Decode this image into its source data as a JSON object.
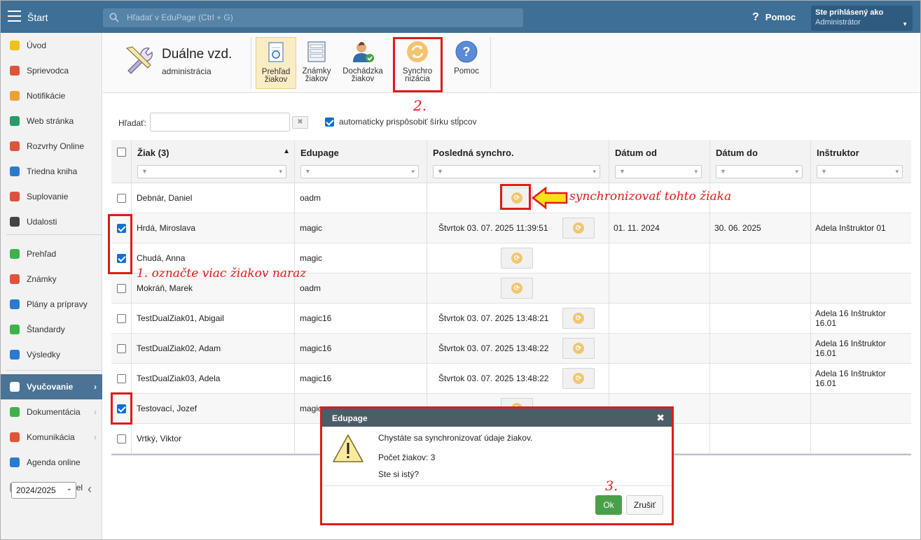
{
  "topbar": {
    "app_label": "Štart",
    "search_placeholder": "Hľadať v EduPage (Ctrl + G)",
    "help_label": "Pomoc",
    "user_title": "Ste prihlásený ako",
    "user_name": "Administrátor"
  },
  "sidebar": {
    "items": [
      {
        "label": "Úvod",
        "icon": "star-icon",
        "color": "#f0c020"
      },
      {
        "label": "Sprievodca",
        "icon": "wand-icon",
        "color": "#e0553a"
      },
      {
        "label": "Notifikácie",
        "icon": "envelope-icon",
        "color": "#f0a030"
      },
      {
        "label": "Web stránka",
        "icon": "home-icon",
        "color": "#2a9a6a"
      },
      {
        "label": "Rozvrhy Online",
        "icon": "calendar-grid-icon",
        "color": "#e0553a"
      },
      {
        "label": "Triedna kniha",
        "icon": "book-icon",
        "color": "#2a7ad0"
      },
      {
        "label": "Suplovanie",
        "icon": "person-icon",
        "color": "#e05040"
      },
      {
        "label": "Udalosti",
        "icon": "calendar-icon",
        "color": "#444444"
      },
      {
        "label": "Prehľad",
        "icon": "check-circle-icon",
        "color": "#3cb34a"
      },
      {
        "label": "Známky",
        "icon": "grade-icon",
        "color": "#e0553a"
      },
      {
        "label": "Plány a prípravy",
        "icon": "briefcase-icon",
        "color": "#2a7ad0"
      },
      {
        "label": "Štandardy",
        "icon": "shield-icon",
        "color": "#3cb34a"
      },
      {
        "label": "Výsledky",
        "icon": "bar-chart-icon",
        "color": "#2a7ad0"
      },
      {
        "label": "Vyučovanie",
        "icon": "open-book-icon",
        "color": "#ffffff"
      },
      {
        "label": "Dokumentácia",
        "icon": "document-icon",
        "color": "#3cb34a"
      },
      {
        "label": "Komunikácia",
        "icon": "chat-icon",
        "color": "#e0553a"
      },
      {
        "label": "Agenda online",
        "icon": "pen-icon",
        "color": "#2a7ad0"
      },
      {
        "label": "Ovládací panel",
        "icon": "gear-icon",
        "color": "#999999"
      }
    ],
    "year": "2024/2025"
  },
  "module": {
    "title": "Duálne vzd.",
    "subtitle": "administrácia"
  },
  "toolbar": {
    "buttons": [
      {
        "line1": "Prehľad",
        "line2": "žiakov"
      },
      {
        "line1": "Známky",
        "line2": "žiakov"
      },
      {
        "line1": "Dochádzka",
        "line2": "žiakov"
      },
      {
        "line1": "Synchro",
        "line2": "nizácia"
      },
      {
        "line1": "Pomoc",
        "line2": ""
      }
    ]
  },
  "filter": {
    "label": "Hľadať:",
    "clear": "✖",
    "autowidth_label": "automaticky prispôsobiť šírku stĺpcov"
  },
  "table": {
    "columns": [
      "Žiak (3)",
      "Edupage",
      "Posledná synchro.",
      "Dátum od",
      "Dátum do",
      "Inštruktor"
    ],
    "sort_indicator": "▲",
    "rows": [
      {
        "name": "Debnár, Daniel",
        "edupage": "oadm",
        "sync": "",
        "from": "",
        "to": "",
        "instr": "",
        "checked": false
      },
      {
        "name": "Hrdá, Miroslava",
        "edupage": "magic",
        "sync": "Štvrtok 03. 07. 2025 11:39:51",
        "from": "01. 11. 2024",
        "to": "30. 06. 2025",
        "instr": "Adela Inštruktor 01",
        "checked": true
      },
      {
        "name": "Chudá, Anna",
        "edupage": "magic",
        "sync": "",
        "from": "",
        "to": "",
        "instr": "",
        "checked": true
      },
      {
        "name": "Mokráň, Marek",
        "edupage": "oadm",
        "sync": "",
        "from": "",
        "to": "",
        "instr": "",
        "checked": false
      },
      {
        "name": "TestDualZiak01, Abigail",
        "edupage": "magic16",
        "sync": "Štvrtok 03. 07. 2025 13:48:21",
        "from": "",
        "to": "",
        "instr": "Adela 16 Inštruktor 16.01",
        "checked": false
      },
      {
        "name": "TestDualZiak02, Adam",
        "edupage": "magic16",
        "sync": "Štvrtok 03. 07. 2025 13:48:22",
        "from": "",
        "to": "",
        "instr": "Adela 16 Inštruktor 16.01",
        "checked": false
      },
      {
        "name": "TestDualZiak03, Adela",
        "edupage": "magic16",
        "sync": "Štvrtok 03. 07. 2025 13:48:22",
        "from": "",
        "to": "",
        "instr": "Adela 16 Inštruktor 16.01",
        "checked": false
      },
      {
        "name": "Testovací, Jozef",
        "edupage": "magic",
        "sync": "",
        "from": "",
        "to": "",
        "instr": "",
        "checked": true
      },
      {
        "name": "Vrtký, Viktor",
        "edupage": "",
        "sync": "",
        "from": "",
        "to": "",
        "instr": "",
        "checked": false
      }
    ]
  },
  "annotations": {
    "step1": "1. označte viac žiakov naraz",
    "step2": "2.",
    "step3": "3.",
    "sync_one": "synchronizovať tohto žiaka"
  },
  "dialog": {
    "title": "Edupage",
    "close": "✖",
    "message": "Chystáte sa synchronizovať údaje žiakov.",
    "count": "Počet žiakov: 3",
    "confirm": "Ste si istý?",
    "ok": "Ok",
    "cancel": "Zrušiť"
  }
}
